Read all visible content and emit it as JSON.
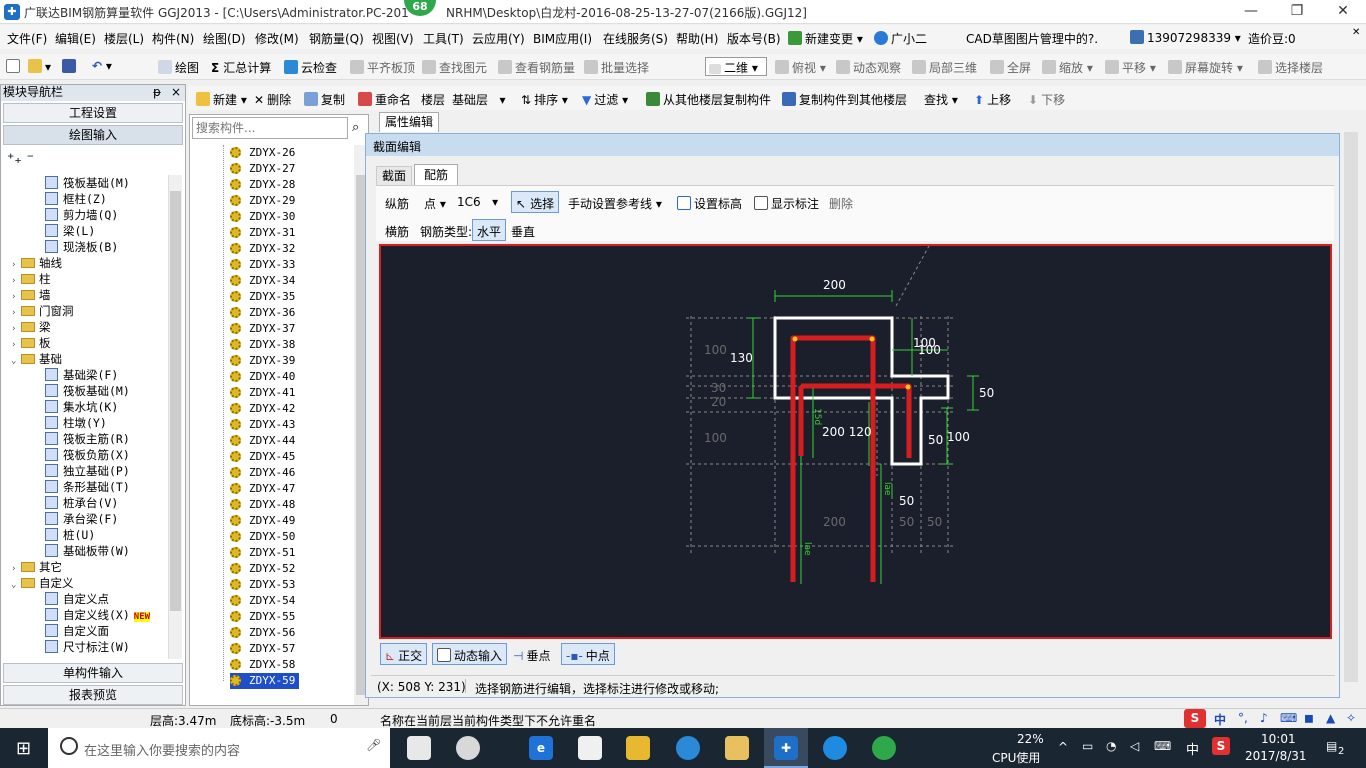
{
  "window": {
    "title": "广联达BIM钢筋算量软件 GGJ2013 - [C:\\Users\\Administrator.PC-201",
    "title_tail": "NRHM\\Desktop\\白龙村-2016-08-25-13-27-07(2166版).GGJ12]",
    "badge": "68",
    "minimize": "—",
    "restore": "❐",
    "close": "✕"
  },
  "menu": {
    "items": [
      "文件(F)",
      "编辑(E)",
      "楼层(L)",
      "构件(N)",
      "绘图(D)",
      "修改(M)",
      "钢筋量(Q)",
      "视图(V)",
      "工具(T)",
      "云应用(Y)",
      "BIM应用(I)",
      "在线服务(S)",
      "帮助(H)",
      "版本号(B)"
    ],
    "new_change": "新建变更",
    "assistant": "广小二",
    "cad_note": "CAD草图图片管理中的?.",
    "phone": "13907298339",
    "beans": "造价豆:0"
  },
  "toolbar1": {
    "draw": "绘图",
    "sum": "汇总计算",
    "cloud_check": "云检查",
    "flat_top": "平齐板顶",
    "find_elem": "查找图元",
    "view_rebar": "查看钢筋量",
    "batch_select": "批量选择",
    "view_mode": "二维",
    "top_view": "俯视",
    "dynamic_view": "动态观察",
    "local_3d": "局部三维",
    "full_screen": "全屏",
    "zoom": "缩放",
    "pan": "平移",
    "rotate": "屏幕旋转",
    "select_floor": "选择楼层"
  },
  "nav": {
    "title": "模块导航栏",
    "pin": "ᵽ",
    "close": "×",
    "project_settings": "工程设置",
    "draw_input": "绘图输入",
    "single_input": "单构件输入",
    "report_preview": "报表预览",
    "tree": [
      {
        "label": "筏板基础(M)",
        "level": 2,
        "type": "leaf"
      },
      {
        "label": "框柱(Z)",
        "level": 2,
        "type": "leaf"
      },
      {
        "label": "剪力墙(Q)",
        "level": 2,
        "type": "leaf"
      },
      {
        "label": "梁(L)",
        "level": 2,
        "type": "leaf"
      },
      {
        "label": "现浇板(B)",
        "level": 2,
        "type": "leaf"
      },
      {
        "label": "轴线",
        "level": 1,
        "type": "folder",
        "exp": "›"
      },
      {
        "label": "柱",
        "level": 1,
        "type": "folder",
        "exp": "›"
      },
      {
        "label": "墙",
        "level": 1,
        "type": "folder",
        "exp": "›"
      },
      {
        "label": "门窗洞",
        "level": 1,
        "type": "folder",
        "exp": "›"
      },
      {
        "label": "梁",
        "level": 1,
        "type": "folder",
        "exp": "›"
      },
      {
        "label": "板",
        "level": 1,
        "type": "folder",
        "exp": "›"
      },
      {
        "label": "基础",
        "level": 1,
        "type": "folder",
        "exp": "⌄"
      },
      {
        "label": "基础梁(F)",
        "level": 2,
        "type": "leaf"
      },
      {
        "label": "筏板基础(M)",
        "level": 2,
        "type": "leaf"
      },
      {
        "label": "集水坑(K)",
        "level": 2,
        "type": "leaf"
      },
      {
        "label": "柱墩(Y)",
        "level": 2,
        "type": "leaf"
      },
      {
        "label": "筏板主筋(R)",
        "level": 2,
        "type": "leaf"
      },
      {
        "label": "筏板负筋(X)",
        "level": 2,
        "type": "leaf"
      },
      {
        "label": "独立基础(P)",
        "level": 2,
        "type": "leaf"
      },
      {
        "label": "条形基础(T)",
        "level": 2,
        "type": "leaf"
      },
      {
        "label": "桩承台(V)",
        "level": 2,
        "type": "leaf"
      },
      {
        "label": "承台梁(F)",
        "level": 2,
        "type": "leaf"
      },
      {
        "label": "桩(U)",
        "level": 2,
        "type": "leaf"
      },
      {
        "label": "基础板带(W)",
        "level": 2,
        "type": "leaf"
      },
      {
        "label": "其它",
        "level": 1,
        "type": "folder",
        "exp": "›"
      },
      {
        "label": "自定义",
        "level": 1,
        "type": "folder",
        "exp": "⌄"
      },
      {
        "label": "自定义点",
        "level": 2,
        "type": "leaf"
      },
      {
        "label": "自定义线(X)",
        "level": 2,
        "type": "leaf",
        "new": "NEW"
      },
      {
        "label": "自定义面",
        "level": 2,
        "type": "leaf"
      },
      {
        "label": "尺寸标注(W)",
        "level": 2,
        "type": "leaf"
      }
    ]
  },
  "toolbar2": {
    "new": "新建",
    "delete": "删除",
    "copy": "复制",
    "rename": "重命名",
    "floor_label": "楼层",
    "floor_value": "基础层",
    "sort": "排序",
    "filter": "过滤",
    "copy_from": "从其他楼层复制构件",
    "copy_to": "复制构件到其他楼层",
    "find": "查找",
    "move_up": "上移",
    "move_down": "下移"
  },
  "list": {
    "search_placeholder": "搜索构件...",
    "items": [
      "ZDYX-26",
      "ZDYX-27",
      "ZDYX-28",
      "ZDYX-29",
      "ZDYX-30",
      "ZDYX-31",
      "ZDYX-32",
      "ZDYX-33",
      "ZDYX-34",
      "ZDYX-35",
      "ZDYX-36",
      "ZDYX-37",
      "ZDYX-38",
      "ZDYX-39",
      "ZDYX-40",
      "ZDYX-41",
      "ZDYX-42",
      "ZDYX-43",
      "ZDYX-44",
      "ZDYX-45",
      "ZDYX-46",
      "ZDYX-47",
      "ZDYX-48",
      "ZDYX-49",
      "ZDYX-50",
      "ZDYX-51",
      "ZDYX-52",
      "ZDYX-53",
      "ZDYX-54",
      "ZDYX-55",
      "ZDYX-56",
      "ZDYX-57",
      "ZDYX-58",
      "ZDYX-59"
    ],
    "selected": "ZDYX-59"
  },
  "props_tab": "属性编辑",
  "dialog": {
    "title": "截面编辑",
    "tabs": [
      "截面",
      "配筋"
    ],
    "row1": {
      "longit": "纵筋",
      "point": "点",
      "spec": "1C6",
      "select": "选择",
      "manual_ref": "手动设置参考线",
      "set_elev": "设置标高",
      "show_dim": "显示标注",
      "delete": "删除"
    },
    "row2": {
      "transverse": "横筋",
      "rebar_type": "钢筋类型:",
      "horizontal": "水平",
      "vertical": "垂直"
    },
    "bottom": {
      "ortho": "正交",
      "dyn_input": "动态输入",
      "perp": "垂点",
      "mid": "中点"
    },
    "status": {
      "coords": "(X: 508 Y: 231)",
      "hint": "选择钢筋进行编辑，选择标注进行修改或移动;"
    }
  },
  "drawing": {
    "dims": {
      "top": "200",
      "left_130": "130",
      "left_100a": "100",
      "left_30": "30",
      "left_20": "20",
      "left_100b": "100",
      "right_100a": "100",
      "right_100b": "100",
      "right_50a": "50",
      "right_50b": "50",
      "right_100c": "100",
      "mid_200_120": "200 120",
      "bot_50": "50",
      "bot_200": "200",
      "bot_50a": "50",
      "bot_50b": "50",
      "lae1": "15d",
      "lae2": "lae",
      "lae3": "lae"
    }
  },
  "statusbar": {
    "floor_height": "层高:3.47m",
    "base_elev": "底标高:-3.5m",
    "zero": "0",
    "message": "名称在当前层当前构件类型下不允许重名"
  },
  "ime": {
    "lang": "中"
  },
  "taskbar": {
    "search": "在这里输入你要搜索的内容",
    "cpu_pct": "22%",
    "cpu_label": "CPU使用",
    "ime": "中",
    "time": "10:01",
    "date": "2017/8/31",
    "notif": "2"
  }
}
